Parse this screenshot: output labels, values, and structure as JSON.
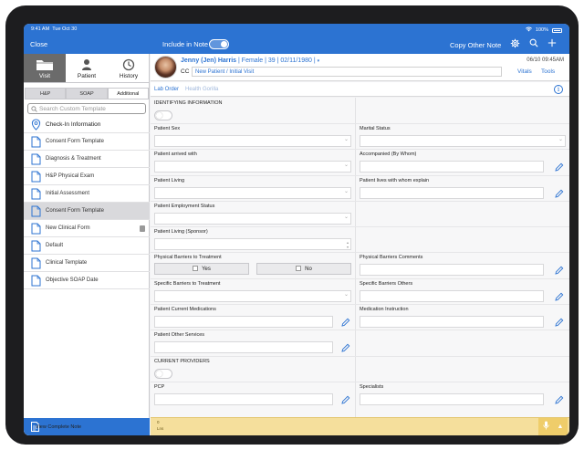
{
  "status_bar": {
    "time": "9:41 AM",
    "date": "Tue Oct 30",
    "battery": "100%"
  },
  "nav": {
    "close": "Close",
    "include_in_note": "Include in Note",
    "copy_other_note": "Copy Other Note",
    "settings_icon": "gear-icon",
    "search_icon": "search-icon",
    "add_icon": "plus-icon"
  },
  "mode_tabs": [
    {
      "label": "Visit",
      "icon": "folder-icon",
      "active": true
    },
    {
      "label": "Patient",
      "icon": "person-icon",
      "active": false
    },
    {
      "label": "History",
      "icon": "history-icon",
      "active": false
    }
  ],
  "sub_tabs": [
    {
      "label": "H&P",
      "active": false
    },
    {
      "label": "SOAP",
      "active": false
    },
    {
      "label": "Additional",
      "active": true
    }
  ],
  "search": {
    "placeholder": "Search Custom Template"
  },
  "templates": [
    {
      "label": "Check-In Information",
      "icon": "location-pin-icon",
      "selected": false
    },
    {
      "label": "Consent Form Template",
      "icon": "document-icon",
      "selected": false
    },
    {
      "label": "Diagnosis & Treatment",
      "icon": "document-icon",
      "selected": false
    },
    {
      "label": "H&P Physical Exam",
      "icon": "document-icon",
      "selected": false
    },
    {
      "label": "Initial Assessment",
      "icon": "document-icon",
      "selected": false
    },
    {
      "label": "Consent Form Template",
      "icon": "document-icon",
      "selected": true
    },
    {
      "label": "New Clinical Form",
      "icon": "document-icon",
      "selected": false
    },
    {
      "label": "Default",
      "icon": "document-icon",
      "selected": false
    },
    {
      "label": "Clinical Template",
      "icon": "document-icon",
      "selected": false
    },
    {
      "label": "Objective SOAP Date",
      "icon": "document-icon",
      "selected": false
    }
  ],
  "view_complete_note": "View Complete Note",
  "patient": {
    "name": "Jenny (Jen) Harris",
    "details": "| Female | 39 | 02/11/1980 |",
    "datetime": "06/10 09:45AM",
    "cc_label": "CC",
    "cc_value": "New Patient / Initial Visit",
    "vitals": "Vitals",
    "tools": "Tools"
  },
  "links": {
    "lab_order": "Lab Order",
    "health_gorilla": "Health Gorilla"
  },
  "form": {
    "identifying_information": "IDENTIFYING INFORMATION",
    "patient_sex": "Patient Sex",
    "marital_status": "Marital Status",
    "patient_arrived_with": "Patient arrived with",
    "accompanied_by_whom": "Accompanied (By Whom)",
    "patient_living": "Patient Living",
    "patient_lives_with_explain": "Patient lives with whom explain",
    "patient_employment_status": "Patient Employment Status",
    "patient_living_sponsor": "Patient Living (Sponsor)",
    "physical_barriers_to_treatment": "Physical Barriers to Treatment",
    "yes": "Yes",
    "no": "No",
    "physical_barriers_comments": "Physical Barriers Comments",
    "specific_barriers_to_treatment": "Specific Barriers to Treatment",
    "specific_barriers_others": "Specific Barriers Others",
    "patient_current_medications": "Patient Current Medications",
    "medication_instruction": "Medication Instruction",
    "patient_other_services": "Patient Other Services",
    "current_providers": "CURRENT PROVIDERS",
    "pcp": "PCP",
    "specialists": "Specialists"
  },
  "bottom_bar": {
    "count": "0",
    "sub": "Lns"
  }
}
